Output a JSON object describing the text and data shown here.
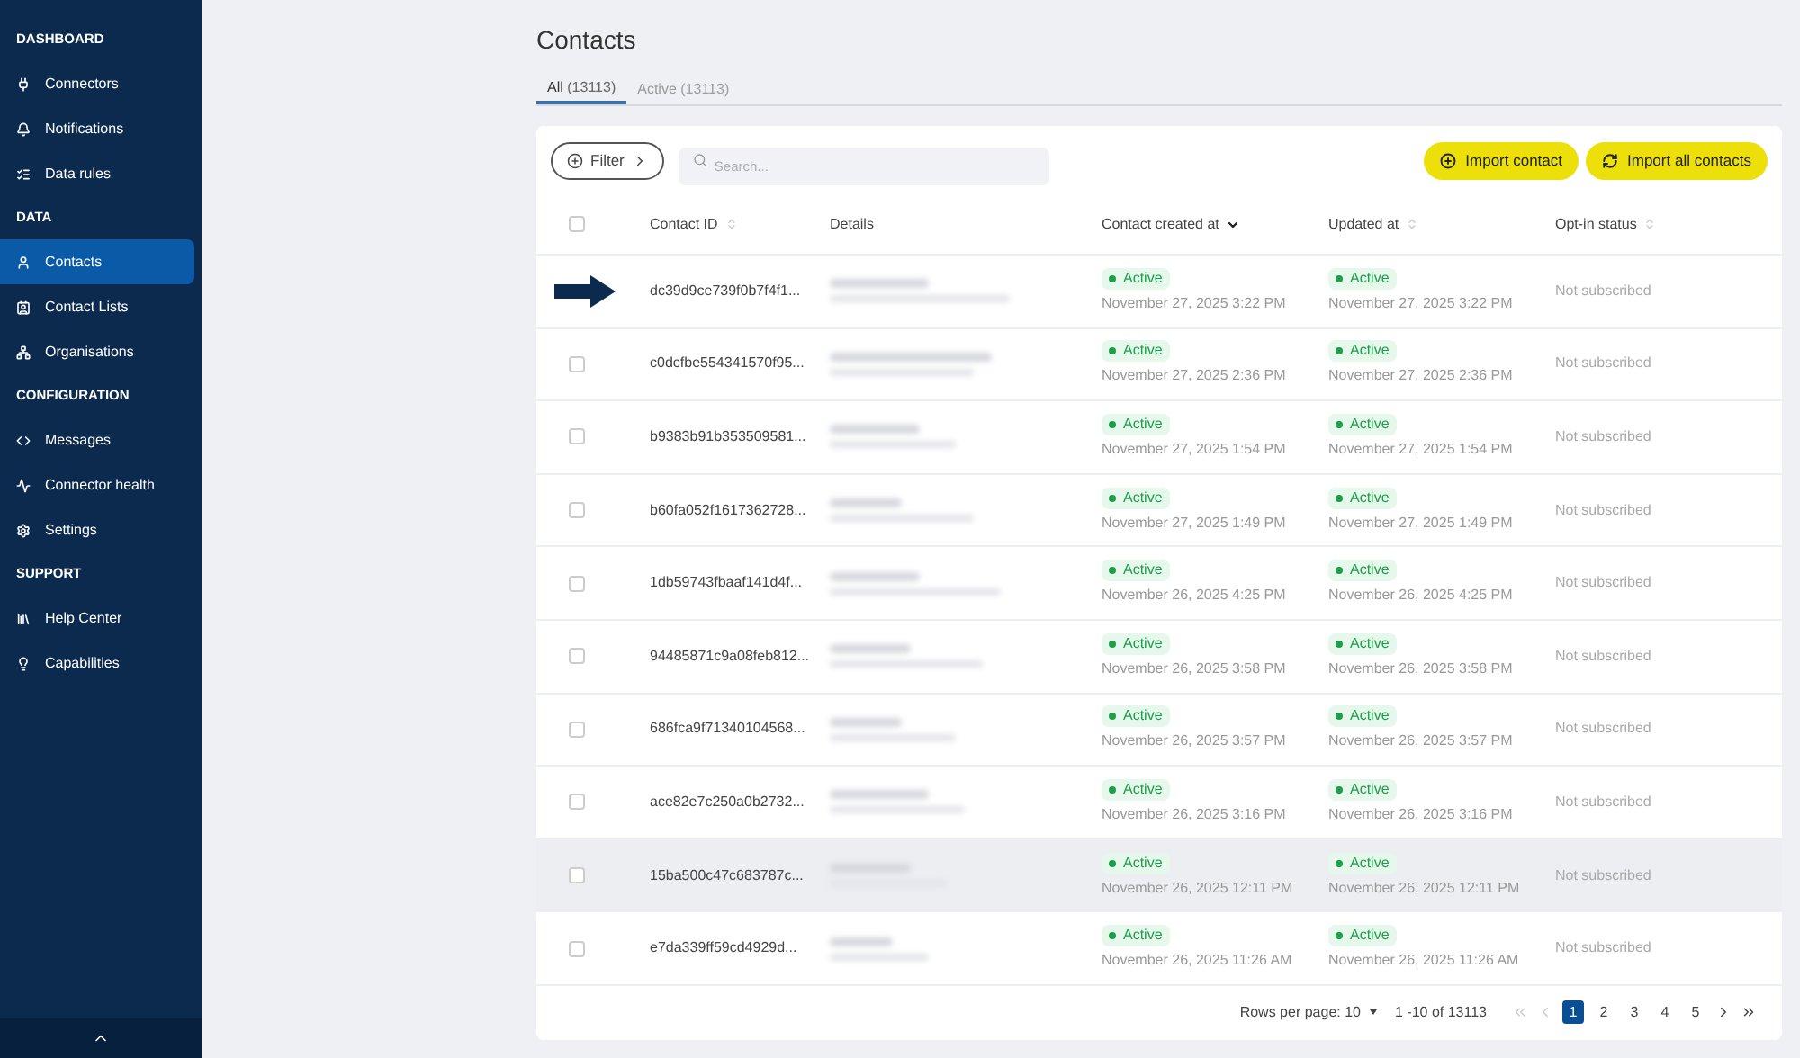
{
  "sidebar": {
    "sections": [
      {
        "title": "DASHBOARD",
        "items": [
          {
            "label": "Connectors",
            "selected": false
          },
          {
            "label": "Notifications",
            "selected": false
          },
          {
            "label": "Data rules",
            "selected": false
          }
        ]
      },
      {
        "title": "DATA",
        "items": [
          {
            "label": "Contacts",
            "selected": true
          },
          {
            "label": "Contact Lists",
            "selected": false
          },
          {
            "label": "Organisations",
            "selected": false
          }
        ]
      },
      {
        "title": "CONFIGURATION",
        "items": [
          {
            "label": "Messages",
            "selected": false
          },
          {
            "label": "Connector health",
            "selected": false
          },
          {
            "label": "Settings",
            "selected": false
          }
        ]
      },
      {
        "title": "SUPPORT",
        "items": [
          {
            "label": "Help Center",
            "selected": false
          },
          {
            "label": "Capabilities",
            "selected": false
          }
        ]
      }
    ]
  },
  "page": {
    "title": "Contacts",
    "tabs": [
      {
        "label": "All",
        "count": "(13113)",
        "selected": true
      },
      {
        "label": "Active",
        "count": "(13113)",
        "selected": false
      }
    ],
    "filter_button": "Filter",
    "search": {
      "placeholder": "Search..."
    },
    "buttons": [
      {
        "label": "Import contact"
      },
      {
        "label": "Import all contacts"
      }
    ],
    "table": {
      "select_all_checked": false,
      "columns": [
        {
          "label": "Contact ID",
          "sorted": false
        },
        {
          "label": "Details"
        },
        {
          "label": "Contact created at",
          "sorted": true
        },
        {
          "label": "Updated at",
          "sorted": false
        },
        {
          "label": "Opt-in status",
          "sorted": false
        }
      ],
      "rows": [
        {
          "kind": "arrow",
          "highlighted": false,
          "id": "dc39d9ce739f0b7f4f1...",
          "created_status": "Active",
          "created": "November 27, 2025 3:22 PM",
          "updated_status": "Active",
          "updated": "November 27, 2025 3:22 PM",
          "optin": "Not subscribed"
        },
        {
          "kind": "checkbox",
          "checked": false,
          "highlighted": false,
          "id": "c0dcfbe554341570f95...",
          "created_status": "Active",
          "created": "November 27, 2025 2:36 PM",
          "updated_status": "Active",
          "updated": "November 27, 2025 2:36 PM",
          "optin": "Not subscribed"
        },
        {
          "kind": "checkbox",
          "checked": false,
          "highlighted": false,
          "id": "b9383b91b353509581...",
          "created_status": "Active",
          "created": "November 27, 2025 1:54 PM",
          "updated_status": "Active",
          "updated": "November 27, 2025 1:54 PM",
          "optin": "Not subscribed"
        },
        {
          "kind": "checkbox",
          "checked": false,
          "highlighted": false,
          "id": "b60fa052f1617362728...",
          "created_status": "Active",
          "created": "November 27, 2025 1:49 PM",
          "updated_status": "Active",
          "updated": "November 27, 2025 1:49 PM",
          "optin": "Not subscribed"
        },
        {
          "kind": "checkbox",
          "checked": false,
          "highlighted": false,
          "id": "1db59743fbaaf141d4f...",
          "created_status": "Active",
          "created": "November 26, 2025 4:25 PM",
          "updated_status": "Active",
          "updated": "November 26, 2025 4:25 PM",
          "optin": "Not subscribed"
        },
        {
          "kind": "checkbox",
          "checked": false,
          "highlighted": false,
          "id": "94485871c9a08feb812...",
          "created_status": "Active",
          "created": "November 26, 2025 3:58 PM",
          "updated_status": "Active",
          "updated": "November 26, 2025 3:58 PM",
          "optin": "Not subscribed"
        },
        {
          "kind": "checkbox",
          "checked": false,
          "highlighted": false,
          "id": "686fca9f71340104568...",
          "created_status": "Active",
          "created": "November 26, 2025 3:57 PM",
          "updated_status": "Active",
          "updated": "November 26, 2025 3:57 PM",
          "optin": "Not subscribed"
        },
        {
          "kind": "checkbox",
          "checked": false,
          "highlighted": false,
          "id": "ace82e7c250a0b2732...",
          "created_status": "Active",
          "created": "November 26, 2025 3:16 PM",
          "updated_status": "Active",
          "updated": "November 26, 2025 3:16 PM",
          "optin": "Not subscribed"
        },
        {
          "kind": "checkbox",
          "checked": false,
          "highlighted": true,
          "id": "15ba500c47c683787c...",
          "created_status": "Active",
          "created": "November 26, 2025 12:11 PM",
          "updated_status": "Active",
          "updated": "November 26, 2025 12:11 PM",
          "optin": "Not subscribed"
        },
        {
          "kind": "checkbox",
          "checked": false,
          "highlighted": false,
          "id": "e7da339ff59cd4929d...",
          "created_status": "Active",
          "created": "November 26, 2025 11:26 AM",
          "updated_status": "Active",
          "updated": "November 26, 2025 11:26 AM",
          "optin": "Not subscribed"
        }
      ]
    },
    "pagination": {
      "rows_per_page": "Rows per page: 10",
      "range": "1 -10 of 13113",
      "first_disabled": true,
      "prev_disabled": true,
      "pages": [
        {
          "label": "1",
          "selected": true
        },
        {
          "label": "2",
          "selected": false
        },
        {
          "label": "3",
          "selected": false
        },
        {
          "label": "4",
          "selected": false
        },
        {
          "label": "5",
          "selected": false
        }
      ],
      "next_disabled": false,
      "last_disabled": false
    }
  }
}
